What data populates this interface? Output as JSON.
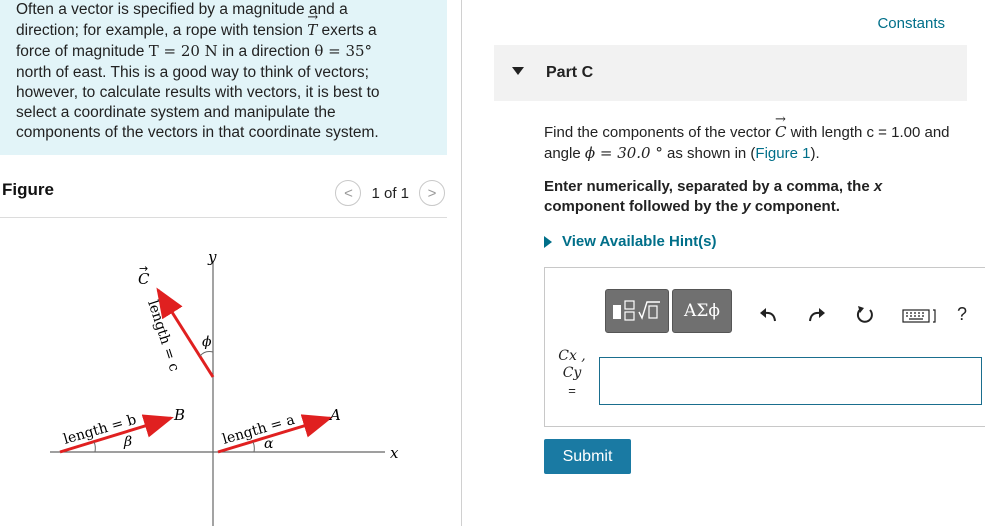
{
  "intro": {
    "line1": "Often a vector is specified by a magnitude and a",
    "line2a": "direction; for example, a rope with tension",
    "line2_var": "T",
    "line2b": "exerts a",
    "line3a": "force of magnitude",
    "line3_eq1": "T = 20 N",
    "line3b": "in a direction",
    "line3_eq2": "θ = 35°",
    "line4": "north of east. This is a good way to think of vectors;",
    "line5": "however, to calculate results with vectors, it is best to",
    "line6": "select a coordinate system and manipulate the",
    "line7": "components of the vectors in that coordinate system."
  },
  "figure": {
    "title": "Figure",
    "pager_text": "1 of 1",
    "prev_icon": "<",
    "next_icon": ">",
    "labels": {
      "y_axis": "y",
      "x_axis": "x",
      "vec_c": "C",
      "vec_b": "B",
      "vec_a": "A",
      "length_c": "length = c",
      "length_b": "length = b",
      "length_a": "length = a",
      "angle_phi": "ϕ",
      "angle_beta": "β",
      "angle_alpha": "α"
    }
  },
  "constants_link": "Constants",
  "part": {
    "title": "Part C"
  },
  "question": {
    "text1": "Find the components of the vector",
    "var_c": "C",
    "text2": "with length",
    "length_eq": "c = 1.00",
    "text3": "and angle",
    "angle_eq": "ϕ = 30.0 °",
    "text4": "as shown in (",
    "figure_link": "Figure 1",
    "text5": ")."
  },
  "instruction": {
    "text1": "Enter numerically, separated by a comma, the",
    "x": "x",
    "text2": "component followed by the",
    "y": "y",
    "text3": "component."
  },
  "hint_label": "View Available Hint(s)",
  "toolbar": {
    "greek_label": "ΑΣϕ",
    "icons": [
      "templates-icon",
      "greek-symbols-icon",
      "undo-icon",
      "redo-icon",
      "reset-icon",
      "keyboard-icon",
      "help-icon"
    ],
    "help_label": "?"
  },
  "answer": {
    "label_top": "Cx ,",
    "label_bottom": "Cy",
    "label_eq": "=",
    "input_value": ""
  },
  "submit_label": "Submit"
}
